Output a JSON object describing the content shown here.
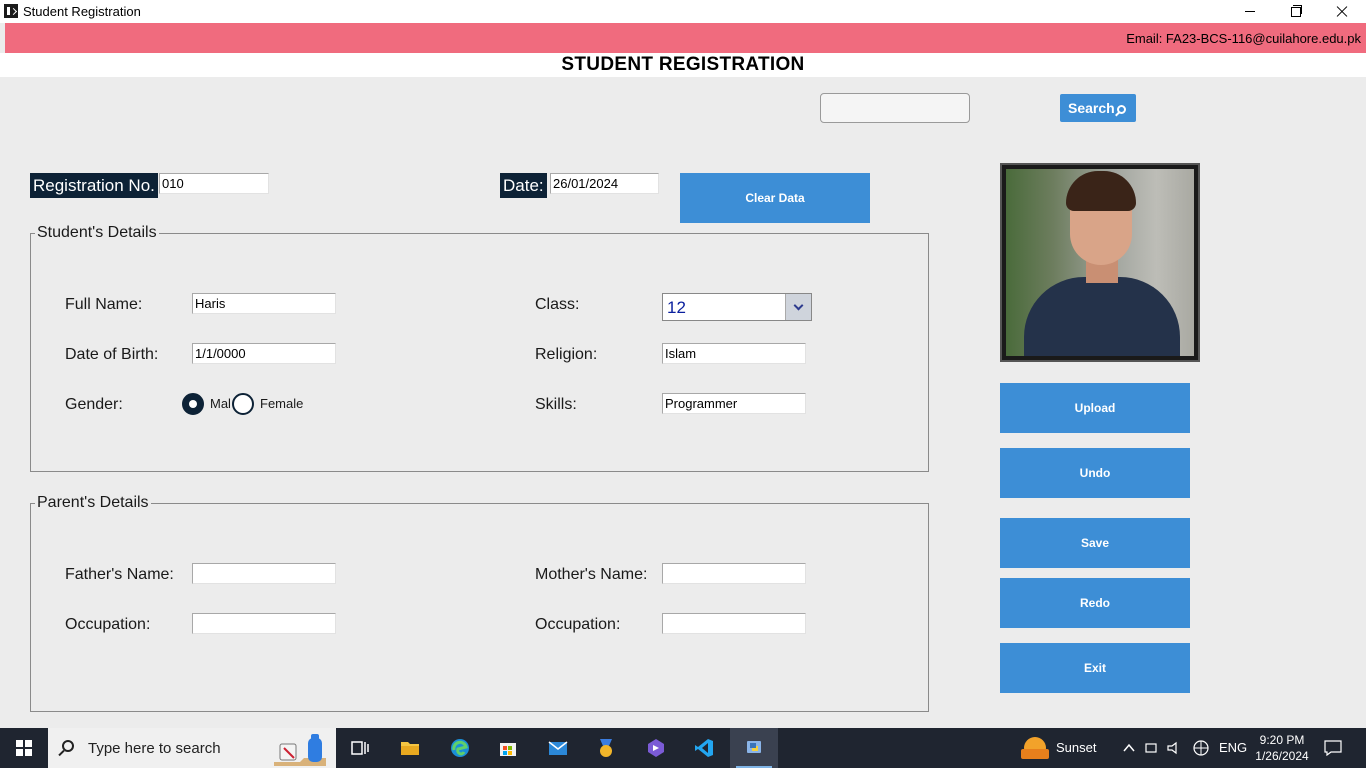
{
  "window": {
    "title": "Student Registration"
  },
  "banner": {
    "email": "Email: FA23-BCS-116@cuilahore.edu.pk",
    "color": "#f06b7e"
  },
  "heading": "STUDENT REGISTRATION",
  "search": {
    "value": "",
    "button_label": "Search"
  },
  "registration": {
    "label": "Registration No.",
    "value": "010"
  },
  "date": {
    "label": "Date:",
    "value": "26/01/2024"
  },
  "clear_button": "Clear Data",
  "student_details": {
    "title": "Student's Details",
    "full_name": {
      "label": "Full Name:",
      "value": "Haris"
    },
    "dob": {
      "label": "Date of Birth:",
      "value": "1/1/0000"
    },
    "gender": {
      "label": "Gender:",
      "options": [
        "Mal",
        "Female"
      ],
      "selected": "Mal"
    },
    "class": {
      "label": "Class:",
      "value": "12"
    },
    "religion": {
      "label": "Religion:",
      "value": "Islam"
    },
    "skills": {
      "label": "Skills:",
      "value": "Programmer"
    }
  },
  "parent_details": {
    "title": "Parent's Details",
    "father_name": {
      "label": "Father's Name:",
      "value": ""
    },
    "father_occupation": {
      "label": "Occupation:",
      "value": ""
    },
    "mother_name": {
      "label": "Mother's Name:",
      "value": ""
    },
    "mother_occupation": {
      "label": "Occupation:",
      "value": ""
    }
  },
  "side_buttons": {
    "upload": "Upload",
    "undo": "Undo",
    "save": "Save",
    "redo": "Redo",
    "exit": "Exit"
  },
  "accent_color": "#3d8ed6",
  "taskbar": {
    "search_placeholder": "Type here to search",
    "weather": "Sunset",
    "language": "ENG",
    "time": "9:20 PM",
    "date": "1/26/2024",
    "pinned_icons": [
      "task-view-icon",
      "file-explorer-icon",
      "edge-icon",
      "store-icon",
      "mail-icon",
      "medal-icon",
      "app-icon",
      "vscode-icon",
      "python-icon"
    ]
  }
}
